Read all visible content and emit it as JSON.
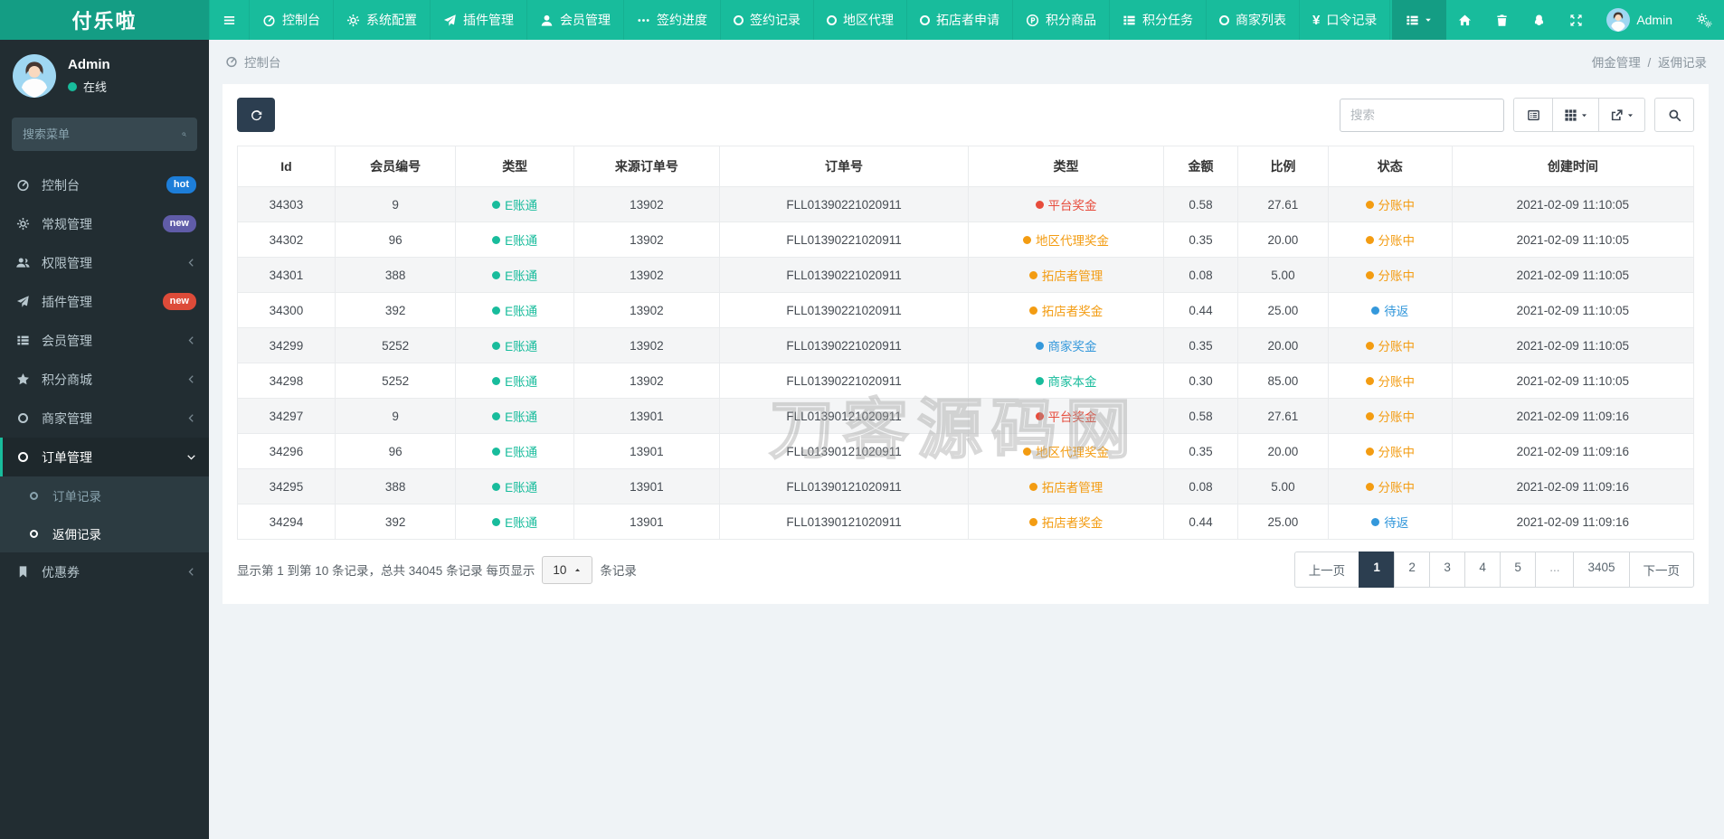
{
  "navbar": {
    "brand": "付乐啦",
    "toggle_icon": "bars-icon",
    "items": [
      {
        "icon": "dashboard-icon",
        "label": "控制台"
      },
      {
        "icon": "gear-icon",
        "label": "系统配置"
      },
      {
        "icon": "paper-plane-icon",
        "label": "插件管理"
      },
      {
        "icon": "user-icon",
        "label": "会员管理"
      },
      {
        "icon": "ellipsis-icon",
        "label": "签约进度"
      },
      {
        "icon": "circle-icon",
        "label": "签约记录"
      },
      {
        "icon": "circle-icon",
        "label": "地区代理"
      },
      {
        "icon": "circle-icon",
        "label": "拓店者申请"
      },
      {
        "icon": "p-circle-icon",
        "label": "积分商品"
      },
      {
        "icon": "list-icon",
        "label": "积分任务"
      },
      {
        "icon": "circle-icon",
        "label": "商家列表"
      },
      {
        "icon": "yen-icon",
        "label": "口令记录"
      }
    ],
    "right_icons": [
      "list-dropdown-icon",
      "home-icon",
      "trash-icon",
      "qq-icon",
      "fullscreen-icon",
      "gears-icon"
    ],
    "admin_label": "Admin",
    "glyphs": {
      "yen": "¥"
    }
  },
  "sidebar": {
    "user": {
      "name": "Admin",
      "status": "在线"
    },
    "search_placeholder": "搜索菜单",
    "items": [
      {
        "icon": "dashboard-icon",
        "label": "控制台",
        "badge": "hot"
      },
      {
        "icon": "gears-icon",
        "label": "常规管理",
        "badge": "new"
      },
      {
        "icon": "users-icon",
        "label": "权限管理"
      },
      {
        "icon": "paper-plane-icon",
        "label": "插件管理",
        "badge": "new"
      },
      {
        "icon": "list-icon",
        "label": "会员管理"
      },
      {
        "icon": "star-icon",
        "label": "积分商城"
      },
      {
        "icon": "circle-icon",
        "label": "商家管理"
      },
      {
        "icon": "circle-icon",
        "label": "订单管理",
        "active": true
      },
      {
        "icon": "bookmark-icon",
        "label": "优惠券"
      }
    ],
    "submenu": [
      {
        "icon": "circle-icon",
        "label": "订单记录"
      },
      {
        "icon": "circle-icon",
        "label": "返佣记录",
        "active": true
      }
    ]
  },
  "breadcrumb": {
    "left": "控制台",
    "right_parent": "佣金管理",
    "right_sep": "/",
    "right_current": "返佣记录"
  },
  "toolbar": {
    "search_placeholder": "搜索"
  },
  "table": {
    "columns": [
      "Id",
      "会员编号",
      "类型",
      "来源订单号",
      "订单号",
      "类型",
      "金额",
      "比例",
      "状态",
      "创建时间"
    ],
    "rows": [
      {
        "id": "34303",
        "member": "9",
        "type": {
          "text": "E账通",
          "color": "green"
        },
        "source": "13902",
        "order": "FLL01390221020911",
        "category": {
          "text": "平台奖金",
          "color": "red"
        },
        "amount": "0.58",
        "ratio": "27.61",
        "status": {
          "text": "分账中",
          "color": "orange"
        },
        "created": "2021-02-09 11:10:05"
      },
      {
        "id": "34302",
        "member": "96",
        "type": {
          "text": "E账通",
          "color": "green"
        },
        "source": "13902",
        "order": "FLL01390221020911",
        "category": {
          "text": "地区代理奖金",
          "color": "orange"
        },
        "amount": "0.35",
        "ratio": "20.00",
        "status": {
          "text": "分账中",
          "color": "orange"
        },
        "created": "2021-02-09 11:10:05"
      },
      {
        "id": "34301",
        "member": "388",
        "type": {
          "text": "E账通",
          "color": "green"
        },
        "source": "13902",
        "order": "FLL01390221020911",
        "category": {
          "text": "拓店者管理",
          "color": "orange"
        },
        "amount": "0.08",
        "ratio": "5.00",
        "status": {
          "text": "分账中",
          "color": "orange"
        },
        "created": "2021-02-09 11:10:05"
      },
      {
        "id": "34300",
        "member": "392",
        "type": {
          "text": "E账通",
          "color": "green"
        },
        "source": "13902",
        "order": "FLL01390221020911",
        "category": {
          "text": "拓店者奖金",
          "color": "orange"
        },
        "amount": "0.44",
        "ratio": "25.00",
        "status": {
          "text": "待返",
          "color": "blue"
        },
        "created": "2021-02-09 11:10:05"
      },
      {
        "id": "34299",
        "member": "5252",
        "type": {
          "text": "E账通",
          "color": "green"
        },
        "source": "13902",
        "order": "FLL01390221020911",
        "category": {
          "text": "商家奖金",
          "color": "blue"
        },
        "amount": "0.35",
        "ratio": "20.00",
        "status": {
          "text": "分账中",
          "color": "orange"
        },
        "created": "2021-02-09 11:10:05"
      },
      {
        "id": "34298",
        "member": "5252",
        "type": {
          "text": "E账通",
          "color": "green"
        },
        "source": "13902",
        "order": "FLL01390221020911",
        "category": {
          "text": "商家本金",
          "color": "green"
        },
        "amount": "0.30",
        "ratio": "85.00",
        "status": {
          "text": "分账中",
          "color": "orange"
        },
        "created": "2021-02-09 11:10:05"
      },
      {
        "id": "34297",
        "member": "9",
        "type": {
          "text": "E账通",
          "color": "green"
        },
        "source": "13901",
        "order": "FLL01390121020911",
        "category": {
          "text": "平台奖金",
          "color": "red"
        },
        "amount": "0.58",
        "ratio": "27.61",
        "status": {
          "text": "分账中",
          "color": "orange"
        },
        "created": "2021-02-09 11:09:16"
      },
      {
        "id": "34296",
        "member": "96",
        "type": {
          "text": "E账通",
          "color": "green"
        },
        "source": "13901",
        "order": "FLL01390121020911",
        "category": {
          "text": "地区代理奖金",
          "color": "orange"
        },
        "amount": "0.35",
        "ratio": "20.00",
        "status": {
          "text": "分账中",
          "color": "orange"
        },
        "created": "2021-02-09 11:09:16"
      },
      {
        "id": "34295",
        "member": "388",
        "type": {
          "text": "E账通",
          "color": "green"
        },
        "source": "13901",
        "order": "FLL01390121020911",
        "category": {
          "text": "拓店者管理",
          "color": "orange"
        },
        "amount": "0.08",
        "ratio": "5.00",
        "status": {
          "text": "分账中",
          "color": "orange"
        },
        "created": "2021-02-09 11:09:16"
      },
      {
        "id": "34294",
        "member": "392",
        "type": {
          "text": "E账通",
          "color": "green"
        },
        "source": "13901",
        "order": "FLL01390121020911",
        "category": {
          "text": "拓店者奖金",
          "color": "orange"
        },
        "amount": "0.44",
        "ratio": "25.00",
        "status": {
          "text": "待返",
          "color": "blue"
        },
        "created": "2021-02-09 11:09:16"
      }
    ]
  },
  "footer": {
    "info_prefix": "显示第 1 到第 10 条记录，总共 34045 条记录 每页显示",
    "page_size": "10",
    "info_suffix": "条记录"
  },
  "pagination": {
    "prev": "上一页",
    "pages": [
      "1",
      "2",
      "3",
      "4",
      "5",
      "...",
      "3405"
    ],
    "active": "1",
    "next": "下一页"
  },
  "colors": {
    "green": "#18bc9c",
    "red": "#e74c3c",
    "orange": "#f39c12",
    "blue": "#3498db",
    "accent": "#18bc9c",
    "navy": "#2c3e50",
    "badge_hot": "#1d7ed9",
    "badge_new_purple": "#605ca8",
    "badge_new_red": "#dd4b39"
  },
  "watermark": "刀客源码网"
}
